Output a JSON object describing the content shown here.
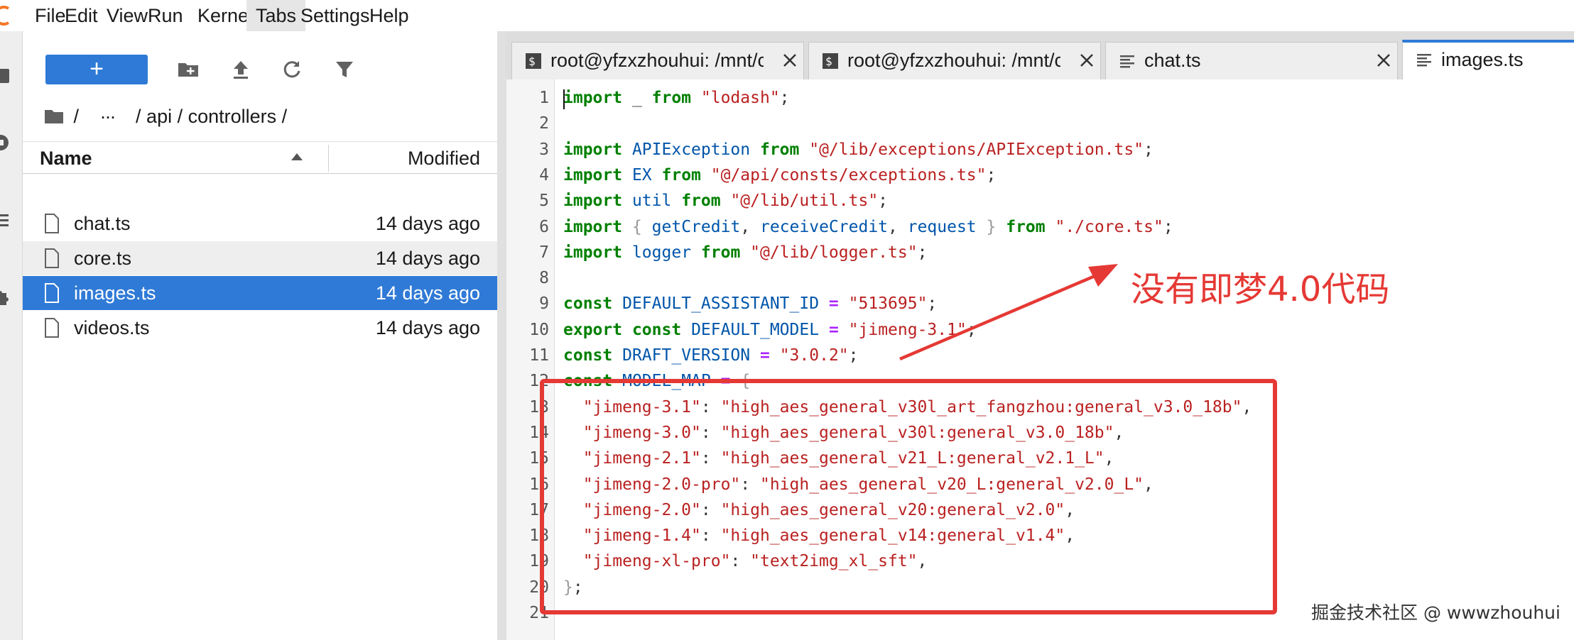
{
  "menu": [
    "File",
    "Edit",
    "View",
    "Run",
    "Kernel",
    "Tabs",
    "Settings",
    "Help"
  ],
  "menu_active": "Tabs",
  "toolbar": {
    "new_label": "+",
    "icons": [
      "new-folder-icon",
      "upload-icon",
      "refresh-icon",
      "filter-icon"
    ]
  },
  "breadcrumb": {
    "root_sep": "/",
    "ellipsis": "···",
    "path": "/ api / controllers /"
  },
  "filelist": {
    "col_name": "Name",
    "col_modified": "Modified",
    "files": [
      {
        "name": "chat.ts",
        "modified": "14 days ago",
        "state": "normal"
      },
      {
        "name": "core.ts",
        "modified": "14 days ago",
        "state": "hover"
      },
      {
        "name": "images.ts",
        "modified": "14 days ago",
        "state": "selected"
      },
      {
        "name": "videos.ts",
        "modified": "14 days ago",
        "state": "normal"
      }
    ]
  },
  "tabs": [
    {
      "label": "root@yfzxzhouhui: /mnt/c",
      "icon": "terminal-icon",
      "active": false
    },
    {
      "label": "root@yfzxzhouhui: /mnt/c",
      "icon": "terminal-icon",
      "active": false
    },
    {
      "label": "chat.ts",
      "icon": "text-file-icon",
      "active": false
    },
    {
      "label": "images.ts",
      "icon": "text-file-icon",
      "active": true
    }
  ],
  "editor": {
    "line_numbers": [
      "1",
      "2",
      "3",
      "4",
      "5",
      "6",
      "7",
      "8",
      "9",
      "10",
      "11",
      "12",
      "13",
      "14",
      "15",
      "16",
      "17",
      "18",
      "19",
      "20",
      "21"
    ],
    "lines": [
      [
        [
          "kw",
          "import"
        ],
        [
          "pun",
          " _ "
        ],
        [
          "kw",
          "from"
        ],
        [
          "pun",
          " "
        ],
        [
          "str",
          "\"lodash\""
        ],
        [
          "pun",
          ";"
        ]
      ],
      [],
      [
        [
          "kw",
          "import"
        ],
        [
          "pun",
          " "
        ],
        [
          "var",
          "APIException"
        ],
        [
          "pun",
          " "
        ],
        [
          "kw",
          "from"
        ],
        [
          "pun",
          " "
        ],
        [
          "str",
          "\"@/lib/exceptions/APIException.ts\""
        ],
        [
          "pun",
          ";"
        ]
      ],
      [
        [
          "kw",
          "import"
        ],
        [
          "pun",
          " "
        ],
        [
          "var",
          "EX"
        ],
        [
          "pun",
          " "
        ],
        [
          "kw",
          "from"
        ],
        [
          "pun",
          " "
        ],
        [
          "str",
          "\"@/api/consts/exceptions.ts\""
        ],
        [
          "pun",
          ";"
        ]
      ],
      [
        [
          "kw",
          "import"
        ],
        [
          "pun",
          " "
        ],
        [
          "var",
          "util"
        ],
        [
          "pun",
          " "
        ],
        [
          "kw",
          "from"
        ],
        [
          "pun",
          " "
        ],
        [
          "str",
          "\"@/lib/util.ts\""
        ],
        [
          "pun",
          ";"
        ]
      ],
      [
        [
          "kw",
          "import"
        ],
        [
          "pun",
          " "
        ],
        [
          "brk",
          "{"
        ],
        [
          "pun",
          " "
        ],
        [
          "var",
          "getCredit"
        ],
        [
          "pun",
          ", "
        ],
        [
          "var",
          "receiveCredit"
        ],
        [
          "pun",
          ", "
        ],
        [
          "var",
          "request"
        ],
        [
          "pun",
          " "
        ],
        [
          "brk",
          "}"
        ],
        [
          "pun",
          " "
        ],
        [
          "kw",
          "from"
        ],
        [
          "pun",
          " "
        ],
        [
          "str",
          "\"./core.ts\""
        ],
        [
          "pun",
          ";"
        ]
      ],
      [
        [
          "kw",
          "import"
        ],
        [
          "pun",
          " "
        ],
        [
          "var",
          "logger"
        ],
        [
          "pun",
          " "
        ],
        [
          "kw",
          "from"
        ],
        [
          "pun",
          " "
        ],
        [
          "str",
          "\"@/lib/logger.ts\""
        ],
        [
          "pun",
          ";"
        ]
      ],
      [],
      [
        [
          "kw",
          "const"
        ],
        [
          "pun",
          " "
        ],
        [
          "var",
          "DEFAULT_ASSISTANT_ID"
        ],
        [
          "pun",
          " "
        ],
        [
          "op",
          "="
        ],
        [
          "pun",
          " "
        ],
        [
          "str",
          "\"513695\""
        ],
        [
          "pun",
          ";"
        ]
      ],
      [
        [
          "kw",
          "export"
        ],
        [
          "pun",
          " "
        ],
        [
          "kw",
          "const"
        ],
        [
          "pun",
          " "
        ],
        [
          "var",
          "DEFAULT_MODEL"
        ],
        [
          "pun",
          " "
        ],
        [
          "op",
          "="
        ],
        [
          "pun",
          " "
        ],
        [
          "str",
          "\"jimeng-3.1\""
        ],
        [
          "pun",
          ";"
        ]
      ],
      [
        [
          "kw",
          "const"
        ],
        [
          "pun",
          " "
        ],
        [
          "var",
          "DRAFT_VERSION"
        ],
        [
          "pun",
          " "
        ],
        [
          "op",
          "="
        ],
        [
          "pun",
          " "
        ],
        [
          "str",
          "\"3.0.2\""
        ],
        [
          "pun",
          ";"
        ]
      ],
      [
        [
          "kw",
          "const"
        ],
        [
          "pun",
          " "
        ],
        [
          "var",
          "MODEL_MAP"
        ],
        [
          "pun",
          " "
        ],
        [
          "op",
          "="
        ],
        [
          "pun",
          " "
        ],
        [
          "brk",
          "{"
        ]
      ],
      [
        [
          "pun",
          "  "
        ],
        [
          "str",
          "\"jimeng-3.1\""
        ],
        [
          "pun",
          ": "
        ],
        [
          "str",
          "\"high_aes_general_v30l_art_fangzhou:general_v3.0_18b\""
        ],
        [
          "pun",
          ","
        ]
      ],
      [
        [
          "pun",
          "  "
        ],
        [
          "str",
          "\"jimeng-3.0\""
        ],
        [
          "pun",
          ": "
        ],
        [
          "str",
          "\"high_aes_general_v30l:general_v3.0_18b\""
        ],
        [
          "pun",
          ","
        ]
      ],
      [
        [
          "pun",
          "  "
        ],
        [
          "str",
          "\"jimeng-2.1\""
        ],
        [
          "pun",
          ": "
        ],
        [
          "str",
          "\"high_aes_general_v21_L:general_v2.1_L\""
        ],
        [
          "pun",
          ","
        ]
      ],
      [
        [
          "pun",
          "  "
        ],
        [
          "str",
          "\"jimeng-2.0-pro\""
        ],
        [
          "pun",
          ": "
        ],
        [
          "str",
          "\"high_aes_general_v20_L:general_v2.0_L\""
        ],
        [
          "pun",
          ","
        ]
      ],
      [
        [
          "pun",
          "  "
        ],
        [
          "str",
          "\"jimeng-2.0\""
        ],
        [
          "pun",
          ": "
        ],
        [
          "str",
          "\"high_aes_general_v20:general_v2.0\""
        ],
        [
          "pun",
          ","
        ]
      ],
      [
        [
          "pun",
          "  "
        ],
        [
          "str",
          "\"jimeng-1.4\""
        ],
        [
          "pun",
          ": "
        ],
        [
          "str",
          "\"high_aes_general_v14:general_v1.4\""
        ],
        [
          "pun",
          ","
        ]
      ],
      [
        [
          "pun",
          "  "
        ],
        [
          "str",
          "\"jimeng-xl-pro\""
        ],
        [
          "pun",
          ": "
        ],
        [
          "str",
          "\"text2img_xl_sft\""
        ],
        [
          "pun",
          ","
        ]
      ],
      [
        [
          "brk",
          "}"
        ],
        [
          "pun",
          ";"
        ]
      ],
      []
    ]
  },
  "annotation": {
    "text": "没有即梦4.0代码",
    "color": "#e53935"
  },
  "watermark": "掘金技术社区 @ wwwzhouhui",
  "colors": {
    "accent": "#2f7ad6",
    "keyword": "#008000",
    "string": "#ba2121",
    "variable": "#0055aa",
    "annotation": "#e53935"
  }
}
